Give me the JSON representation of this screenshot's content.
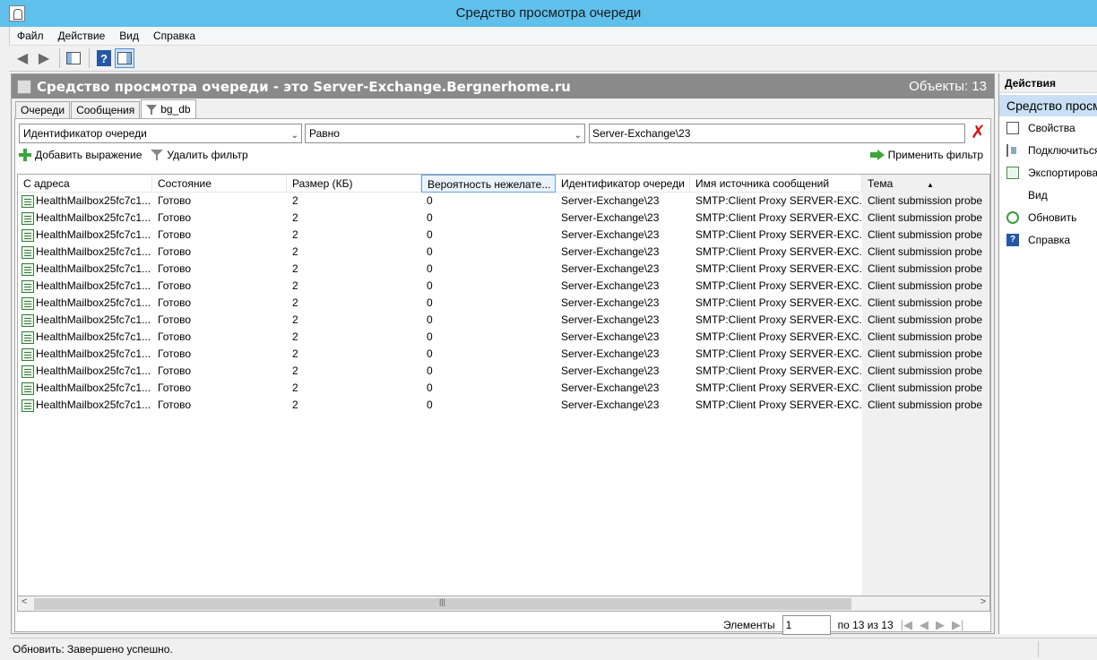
{
  "window": {
    "title": "Средство просмотра очереди"
  },
  "menu": [
    "Файл",
    "Действие",
    "Вид",
    "Справка"
  ],
  "toolbar": {
    "back_icon": "back-arrow-icon",
    "forward_icon": "forward-arrow-icon",
    "help_label": "?"
  },
  "main": {
    "header_title": "Средство просмотра очереди - это Server-Exchange.Bergnerhome.ru",
    "objects_count": "Объекты: 13",
    "tabs": [
      "Очереди",
      "Сообщения",
      "bg_db"
    ],
    "filter": {
      "field": "Идентификатор очереди",
      "operator": "Равно",
      "value": "Server-Exchange\\23",
      "add_expression": "Добавить выражение",
      "remove_filter": "Удалить фильтр",
      "apply_filter": "Применить фильтр"
    },
    "columns": [
      "С адреса",
      "Состояние",
      "Размер (КБ)",
      "Вероятность нежелате...",
      "Идентификатор очереди",
      "Имя источника сообщений",
      "Тема"
    ],
    "rows": [
      [
        "HealthMailbox25fc7c1...",
        "Готово",
        "2",
        "0",
        "Server-Exchange\\23",
        "SMTP:Client Proxy SERVER-EXC...",
        "Client submission probe"
      ],
      [
        "HealthMailbox25fc7c1...",
        "Готово",
        "2",
        "0",
        "Server-Exchange\\23",
        "SMTP:Client Proxy SERVER-EXC...",
        "Client submission probe"
      ],
      [
        "HealthMailbox25fc7c1...",
        "Готово",
        "2",
        "0",
        "Server-Exchange\\23",
        "SMTP:Client Proxy SERVER-EXC...",
        "Client submission probe"
      ],
      [
        "HealthMailbox25fc7c1...",
        "Готово",
        "2",
        "0",
        "Server-Exchange\\23",
        "SMTP:Client Proxy SERVER-EXC...",
        "Client submission probe"
      ],
      [
        "HealthMailbox25fc7c1...",
        "Готово",
        "2",
        "0",
        "Server-Exchange\\23",
        "SMTP:Client Proxy SERVER-EXC...",
        "Client submission probe"
      ],
      [
        "HealthMailbox25fc7c1...",
        "Готово",
        "2",
        "0",
        "Server-Exchange\\23",
        "SMTP:Client Proxy SERVER-EXC...",
        "Client submission probe"
      ],
      [
        "HealthMailbox25fc7c1...",
        "Готово",
        "2",
        "0",
        "Server-Exchange\\23",
        "SMTP:Client Proxy SERVER-EXC...",
        "Client submission probe"
      ],
      [
        "HealthMailbox25fc7c1...",
        "Готово",
        "2",
        "0",
        "Server-Exchange\\23",
        "SMTP:Client Proxy SERVER-EXC...",
        "Client submission probe"
      ],
      [
        "HealthMailbox25fc7c1...",
        "Готово",
        "2",
        "0",
        "Server-Exchange\\23",
        "SMTP:Client Proxy SERVER-EXC...",
        "Client submission probe"
      ],
      [
        "HealthMailbox25fc7c1...",
        "Готово",
        "2",
        "0",
        "Server-Exchange\\23",
        "SMTP:Client Proxy SERVER-EXC...",
        "Client submission probe"
      ],
      [
        "HealthMailbox25fc7c1...",
        "Готово",
        "2",
        "0",
        "Server-Exchange\\23",
        "SMTP:Client Proxy SERVER-EXC...",
        "Client submission probe"
      ],
      [
        "HealthMailbox25fc7c1...",
        "Готово",
        "2",
        "0",
        "Server-Exchange\\23",
        "SMTP:Client Proxy SERVER-EXC...",
        "Client submission probe"
      ],
      [
        "HealthMailbox25fc7c1...",
        "Готово",
        "2",
        "0",
        "Server-Exchange\\23",
        "SMTP:Client Proxy SERVER-EXC...",
        "Client submission probe"
      ]
    ],
    "pager": {
      "label": "Элементы",
      "current": "1",
      "of_text": "по 13 из 13"
    }
  },
  "actions": {
    "header": "Действия",
    "section": "Средство просмотра очереди",
    "items": [
      {
        "label": "Свойства",
        "icon": "properties-icon"
      },
      {
        "label": "Подключиться к серверу...",
        "icon": "connect-icon"
      },
      {
        "label": "Экспортировать список...",
        "icon": "export-icon"
      },
      {
        "label": "Вид",
        "icon": ""
      },
      {
        "label": "Обновить",
        "icon": "refresh-icon"
      },
      {
        "label": "Справка",
        "icon": "help-icon"
      }
    ]
  },
  "status": {
    "text": "Обновить:  Завершено успешно."
  }
}
